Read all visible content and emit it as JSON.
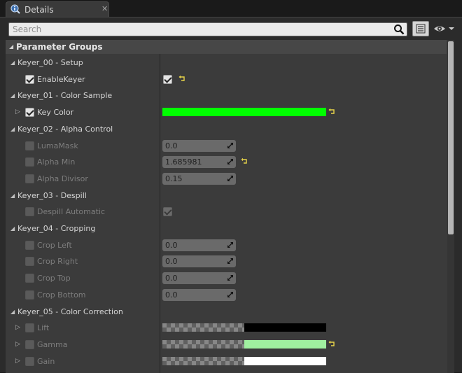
{
  "tab": {
    "title": "Details",
    "close": "✕"
  },
  "search": {
    "placeholder": "Search",
    "value": ""
  },
  "group": {
    "title": "Parameter Groups"
  },
  "colors": {
    "key_color": "#00ff00",
    "lift": "#000000",
    "gamma": "#a0f0a0",
    "gain": "#ffffff"
  },
  "rows": [
    {
      "kind": "cat",
      "label": "Keyer_00 - Setup"
    },
    {
      "kind": "prop",
      "label": "EnableKeyer",
      "enabled": true,
      "checked": true,
      "value_type": "bool",
      "value_checked": true,
      "reset": true
    },
    {
      "kind": "cat",
      "label": "Keyer_01 - Color Sample"
    },
    {
      "kind": "prop",
      "label": "Key Color",
      "enabled": true,
      "checked": true,
      "expandable": true,
      "value_type": "color",
      "color_key": "key_color",
      "reset": true
    },
    {
      "kind": "cat",
      "label": "Keyer_02 - Alpha Control"
    },
    {
      "kind": "prop",
      "label": "LumaMask",
      "enabled": false,
      "checked": false,
      "value_type": "number",
      "value": "0.0"
    },
    {
      "kind": "prop",
      "label": "Alpha Min",
      "enabled": false,
      "checked": false,
      "value_type": "number",
      "value": "1.685981",
      "reset": true
    },
    {
      "kind": "prop",
      "label": "Alpha Divisor",
      "enabled": false,
      "checked": false,
      "value_type": "number",
      "value": "0.15"
    },
    {
      "kind": "cat",
      "label": "Keyer_03 - Despill"
    },
    {
      "kind": "prop",
      "label": "Despill Automatic",
      "enabled": false,
      "checked": false,
      "value_type": "bool",
      "value_checked": true
    },
    {
      "kind": "cat",
      "label": "Keyer_04 - Cropping"
    },
    {
      "kind": "prop",
      "label": "Crop Left",
      "enabled": false,
      "checked": false,
      "value_type": "number",
      "value": "0.0"
    },
    {
      "kind": "prop",
      "label": "Crop Right",
      "enabled": false,
      "checked": false,
      "value_type": "number",
      "value": "0.0"
    },
    {
      "kind": "prop",
      "label": "Crop Top",
      "enabled": false,
      "checked": false,
      "value_type": "number",
      "value": "0.0"
    },
    {
      "kind": "prop",
      "label": "Crop Bottom",
      "enabled": false,
      "checked": false,
      "value_type": "number",
      "value": "0.0"
    },
    {
      "kind": "cat",
      "label": "Keyer_05 - Color Correction"
    },
    {
      "kind": "prop",
      "label": "Lift",
      "enabled": false,
      "checked": false,
      "expandable": true,
      "value_type": "linearcolor",
      "color_key": "lift"
    },
    {
      "kind": "prop",
      "label": "Gamma",
      "enabled": false,
      "checked": false,
      "expandable": true,
      "value_type": "linearcolor",
      "color_key": "gamma",
      "reset": true
    },
    {
      "kind": "prop",
      "label": "Gain",
      "enabled": false,
      "checked": false,
      "expandable": true,
      "value_type": "linearcolor",
      "color_key": "gain"
    }
  ]
}
